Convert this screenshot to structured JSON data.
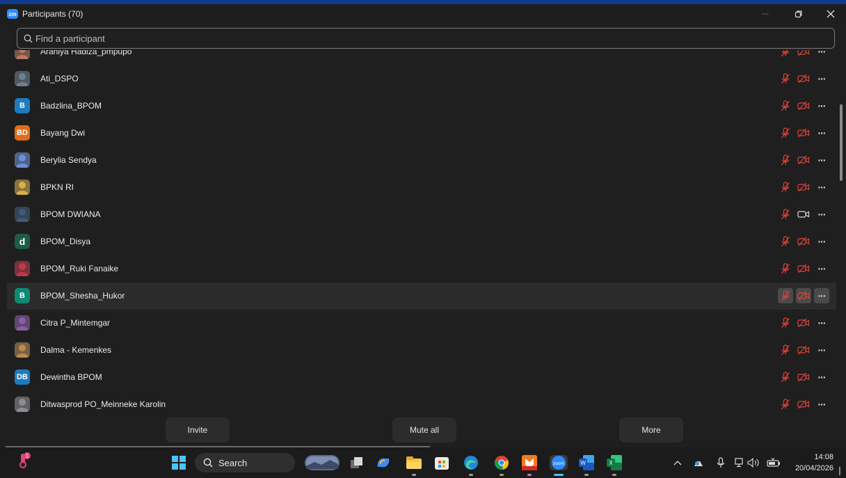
{
  "window": {
    "app_logo": "zm",
    "title": "Participants (70)",
    "minimize_icon": "minimize-icon",
    "restore_icon": "restore-icon",
    "close_icon": "close-icon"
  },
  "search": {
    "placeholder": "Find a participant",
    "icon": "search-icon"
  },
  "colors": {
    "muted_red": "#e0433a",
    "avatar_blue": "#1e7bbf",
    "avatar_orange": "#e06c1a",
    "avatar_green": "#1d5c45",
    "avatar_teal": "#0e8a73"
  },
  "participants": [
    {
      "name": "Arahiya Hadiza_pmpupo",
      "avatar": {
        "type": "photo",
        "color": "#b97a62"
      },
      "audio": "muted",
      "video": "off",
      "partial": true
    },
    {
      "name": "Ati_DSPO",
      "avatar": {
        "type": "photo",
        "color": "#6f7f92"
      },
      "audio": "muted",
      "video": "off"
    },
    {
      "name": "Badzlina_BPOM",
      "avatar": {
        "type": "initials",
        "initials": "B",
        "color": "#1e7bbf"
      },
      "audio": "muted",
      "video": "off"
    },
    {
      "name": "Bayang Dwi",
      "avatar": {
        "type": "initials",
        "initials": "BD",
        "color": "#e06c1a"
      },
      "audio": "muted",
      "video": "off"
    },
    {
      "name": "Berylia Sendya",
      "avatar": {
        "type": "photo",
        "color": "#6d8fd8"
      },
      "audio": "muted",
      "video": "off"
    },
    {
      "name": "BPKN RI",
      "avatar": {
        "type": "photo",
        "color": "#d6b04a"
      },
      "audio": "muted",
      "video": "off"
    },
    {
      "name": "BPOM DWIANA",
      "avatar": {
        "type": "photo",
        "color": "#3f5a78"
      },
      "audio": "muted",
      "video": "on"
    },
    {
      "name": "BPOM_Disya",
      "avatar": {
        "type": "initials",
        "initials": "d",
        "color": "#1d5c45"
      },
      "audio": "muted",
      "video": "off"
    },
    {
      "name": "BPOM_Ruki Fanaike",
      "avatar": {
        "type": "photo",
        "color": "#c0394a"
      },
      "audio": "muted",
      "video": "off"
    },
    {
      "name": "BPOM_Shesha_Hukor",
      "avatar": {
        "type": "initials",
        "initials": "B",
        "color": "#0e8a73"
      },
      "audio": "muted",
      "video": "off",
      "highlighted": true
    },
    {
      "name": "Citra P_Mintemgar",
      "avatar": {
        "type": "photo",
        "color": "#8a5fa8"
      },
      "audio": "muted",
      "video": "off"
    },
    {
      "name": "Dalma - Kemenkes",
      "avatar": {
        "type": "photo",
        "color": "#b98a55"
      },
      "audio": "muted",
      "video": "off"
    },
    {
      "name": "Dewintha BPOM",
      "avatar": {
        "type": "initials",
        "initials": "DB",
        "color": "#1e7bbf"
      },
      "audio": "muted",
      "video": "off"
    },
    {
      "name": "Ditwasprod PO_Meinneke Karolin",
      "avatar": {
        "type": "photo",
        "color": "#8d8d96"
      },
      "audio": "muted",
      "video": "off"
    }
  ],
  "footer": {
    "invite_label": "Invite",
    "mute_all_label": "Mute all",
    "more_label": "More"
  },
  "taskbar": {
    "search_label": "Search",
    "apps": [
      "notification-app-icon",
      "windows-start-icon",
      "search-icon",
      "landscape-widget-icon",
      "task-view-icon",
      "copilot-icon",
      "file-explorer-icon",
      "microsoft-store-icon",
      "edge-icon",
      "chrome-icon",
      "reader-app-icon",
      "zoom-icon",
      "word-icon",
      "excel-icon"
    ],
    "notification_badge": "1",
    "time": "14:08",
    "date": "20/04/2026"
  }
}
